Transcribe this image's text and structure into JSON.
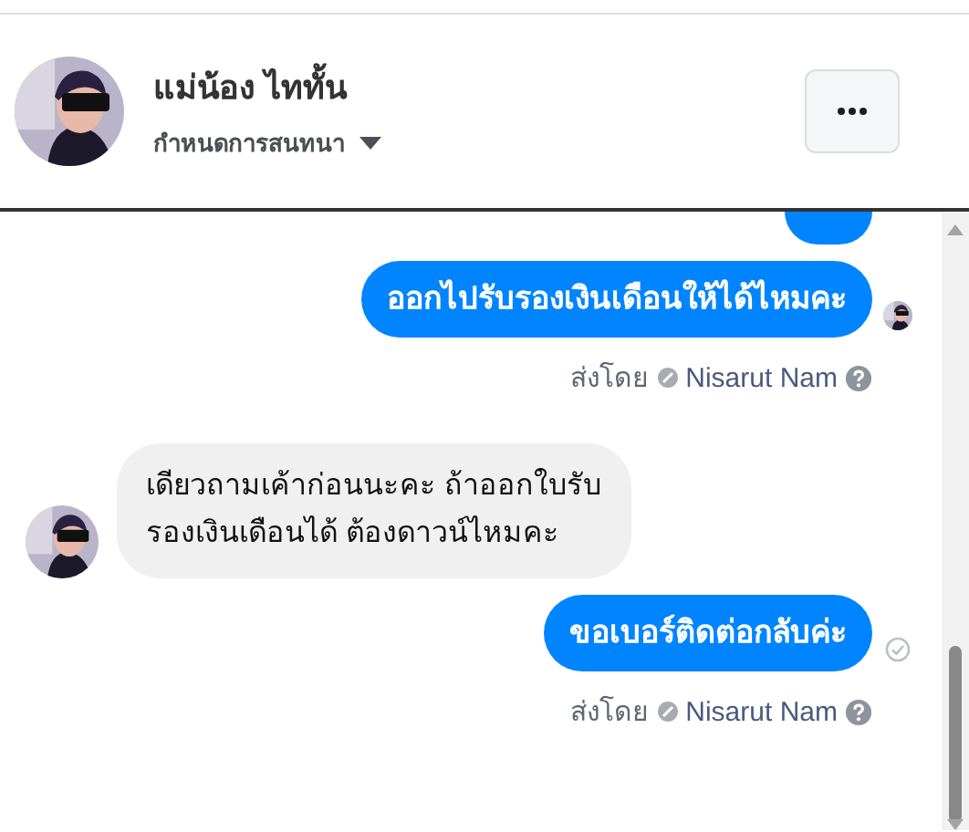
{
  "header": {
    "contact_name": "แม่น้อง ไททั้น",
    "subtitle": "กำหนดการสนทนา"
  },
  "messages": [
    {
      "kind": "outgoing-cut"
    },
    {
      "kind": "outgoing",
      "text": "ออกไปรับรองเงินเดือนให้ได้ไหมคะ",
      "seen": true,
      "sent_by_label": "ส่งโดย",
      "sender": "Nisarut Nam"
    },
    {
      "kind": "incoming",
      "text": "เดียวถามเค้าก่อนนะคะ ถ้าออกใบรับรองเงินเดือนได้ ต้องดาวน์ไหมคะ"
    },
    {
      "kind": "outgoing",
      "text": "ขอเบอร์ติดต่อกลับค่ะ",
      "seen": false,
      "sent_by_label": "ส่งโดย",
      "sender": "Nisarut Nam"
    }
  ]
}
